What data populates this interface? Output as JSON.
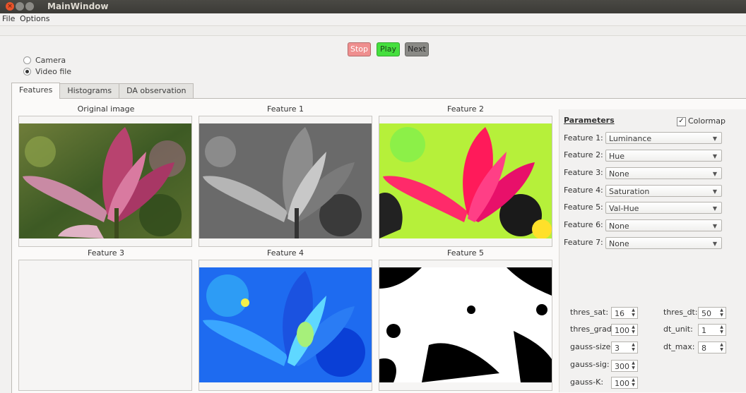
{
  "window": {
    "title": "MainWindow"
  },
  "menu": [
    "File",
    "Options"
  ],
  "controls": {
    "stop": "Stop",
    "play": "Play",
    "next": "Next",
    "colors": {
      "stop": "#ef8f8f",
      "play": "#45df3e",
      "next": "#8a8a86"
    }
  },
  "source": {
    "camera": "Camera",
    "video": "Video file",
    "selected": "Video file"
  },
  "tabs": [
    "Features",
    "Histograms",
    "DA observation"
  ],
  "images": {
    "original": "Original image",
    "f1": "Feature 1",
    "f2": "Feature 2",
    "f3": "Feature 3",
    "f4": "Feature 4",
    "f5": "Feature 5"
  },
  "params": {
    "title": "Parameters",
    "colormap": "Colormap",
    "colormap_checked": true,
    "features": [
      {
        "label": "Feature 1:",
        "value": "Luminance"
      },
      {
        "label": "Feature 2:",
        "value": "Hue"
      },
      {
        "label": "Feature 3:",
        "value": "None"
      },
      {
        "label": "Feature 4:",
        "value": "Saturation"
      },
      {
        "label": "Feature 5:",
        "value": "Val-Hue"
      },
      {
        "label": "Feature 6:",
        "value": "None"
      },
      {
        "label": "Feature 7:",
        "value": "None"
      }
    ],
    "spins_left": [
      {
        "label": "thres_sat:",
        "value": "16"
      },
      {
        "label": "thres_grad:",
        "value": "100"
      },
      {
        "label": "gauss-size:",
        "value": "3"
      },
      {
        "label": "gauss-sig:",
        "value": "300"
      },
      {
        "label": "gauss-K:",
        "value": "100"
      }
    ],
    "spins_right": [
      {
        "label": "thres_dt:",
        "value": "50"
      },
      {
        "label": "dt_unit:",
        "value": "1"
      },
      {
        "label": "dt_max:",
        "value": "8"
      }
    ]
  }
}
